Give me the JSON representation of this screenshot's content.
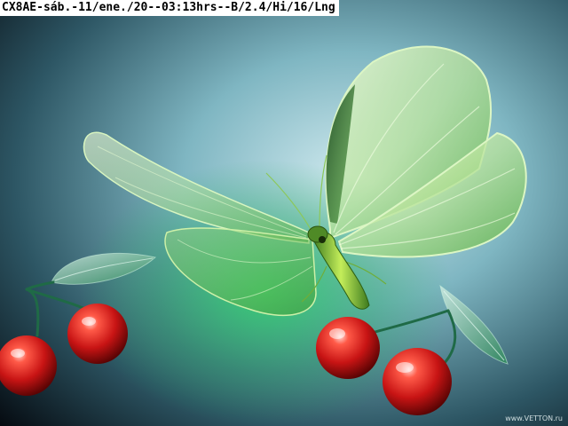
{
  "caption": {
    "text": "CX8AE-sáb.-11/ene./20--03:13hrs--B/2.4/Hi/16/Lng",
    "background": "#ffffff",
    "color": "#000000"
  },
  "watermark": {
    "text": "www.VETTON.ru"
  },
  "scene": {
    "subjects": [
      "glass-butterfly",
      "cherry-pair-left",
      "cherry-pair-right"
    ],
    "colors": {
      "background_dark": "#0a1420",
      "background_light": "#a8d4dc",
      "wing_green": "#7ac85a",
      "cherry_red": "#d21818"
    }
  }
}
